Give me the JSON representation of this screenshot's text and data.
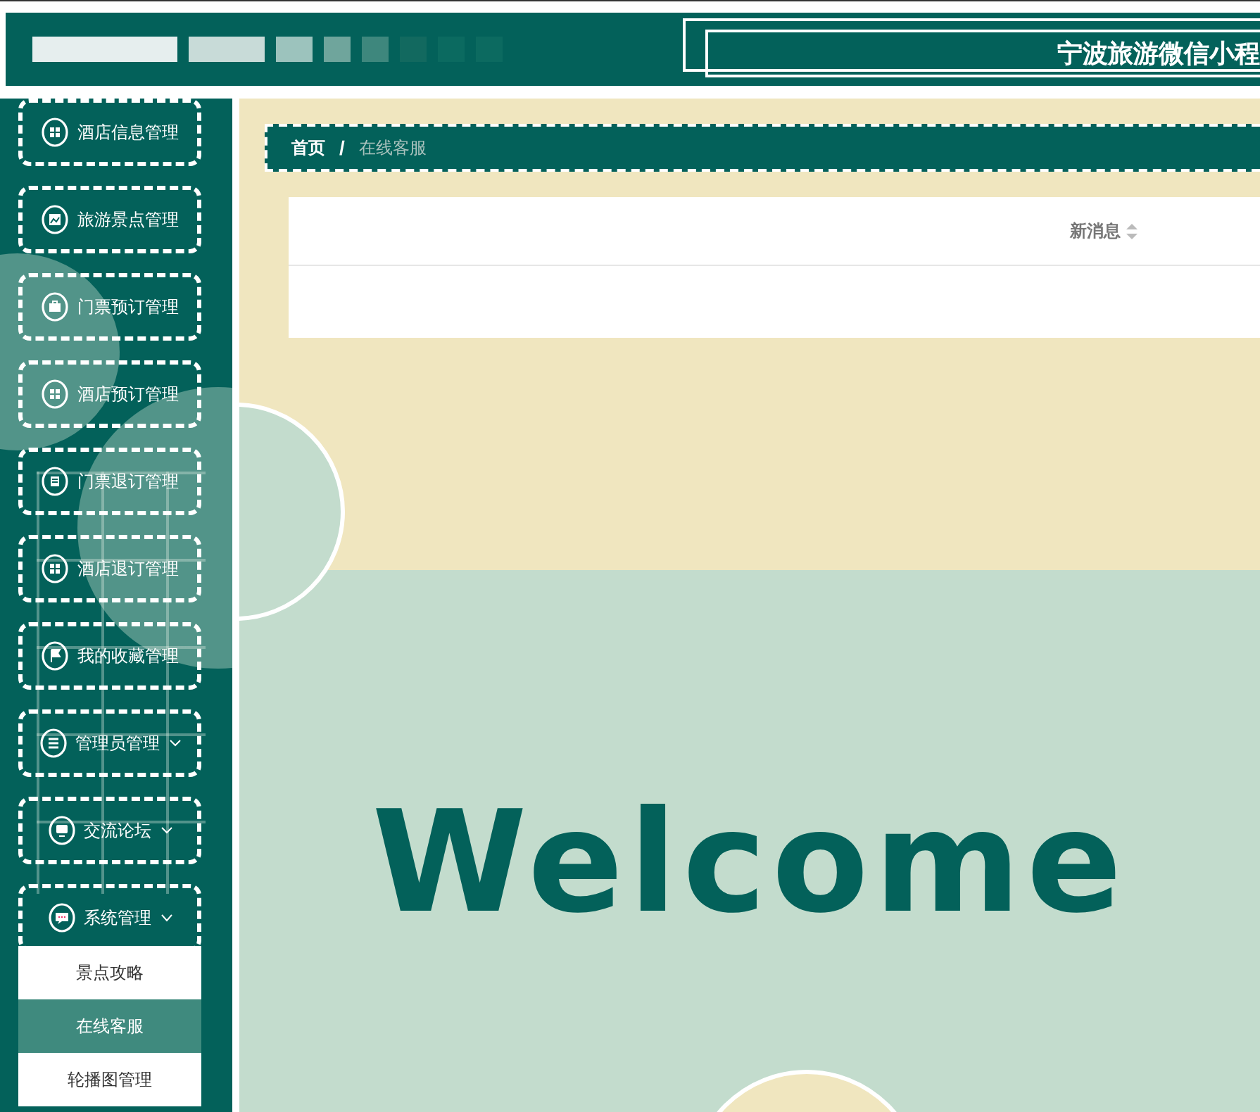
{
  "header": {
    "title": "宁波旅游微信小程"
  },
  "menu": [
    {
      "label": "酒店信息管理",
      "kind": "grid"
    },
    {
      "label": "旅游景点管理",
      "kind": "chart"
    },
    {
      "label": "门票预订管理",
      "kind": "briefcase"
    },
    {
      "label": "酒店预订管理",
      "kind": "grid"
    },
    {
      "label": "门票退订管理",
      "kind": "document"
    },
    {
      "label": "酒店退订管理",
      "kind": "grid"
    },
    {
      "label": "我的收藏管理",
      "kind": "flag"
    },
    {
      "label": "管理员管理",
      "kind": "list",
      "expanded": false
    },
    {
      "label": "交流论坛",
      "kind": "monitor",
      "expanded": false
    },
    {
      "label": "系统管理",
      "kind": "chat",
      "expanded": true,
      "children": [
        {
          "label": "景点攻略",
          "selected": false
        },
        {
          "label": "在线客服",
          "selected": true
        },
        {
          "label": "轮播图管理",
          "selected": false
        }
      ]
    }
  ],
  "breadcrumb": {
    "separator": "/",
    "items": [
      {
        "label": "首页",
        "current": false
      },
      {
        "label": "在线客服",
        "current": true
      }
    ]
  },
  "table": {
    "columns": [
      {
        "label": "新消息",
        "sortable": true
      }
    ]
  },
  "welcome": "Welcome"
}
